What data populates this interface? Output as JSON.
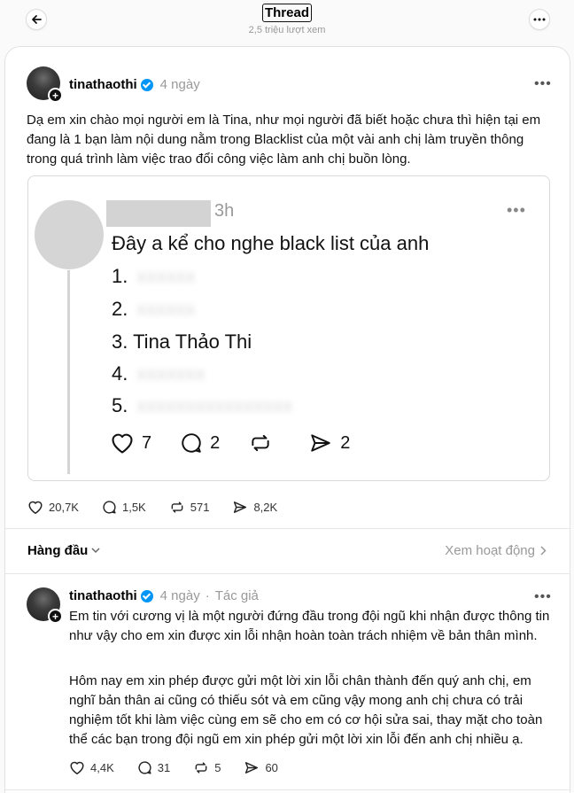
{
  "header": {
    "title": "Thread",
    "views": "2,5 triệu lượt xem"
  },
  "post": {
    "username": "tinathaothi",
    "time": "4 ngày",
    "text": "Dạ em xin chào mọi người em là Tina, như mọi người đã biết hoặc chưa thì hiện tại em đang là 1 bạn làm nội dung nằm trong Blacklist của một vài anh chị làm truyền thông trong quá trình làm việc trao đổi công việc làm anh chị buồn lòng.",
    "embed": {
      "time": "3h",
      "text": "Đây a kể cho nghe black list của anh",
      "list": [
        "1.",
        "2.",
        "3. Tina Thảo Thi",
        "4.",
        "5."
      ],
      "likes": "7",
      "replies": "2",
      "shares": "2"
    },
    "likes": "20,7K",
    "replies": "1,5K",
    "reposts": "571",
    "shares": "8,2K"
  },
  "sort": {
    "label": "Hàng đầu",
    "activity": "Xem hoạt động"
  },
  "reply": {
    "username": "tinathaothi",
    "time": "4 ngày",
    "author_tag": "Tác giả",
    "paragraph1": "Em tin với cương vị là một người đứng đầu trong đội ngũ khi nhận được thông tin như vậy cho em xin được xin lỗi nhận hoàn toàn trách nhiệm về bản thân mình.",
    "paragraph2": "Hôm nay em xin phép được gửi một lời xin lỗi chân thành đến quý anh chị, em nghĩ bản thân ai cũng có thiếu sót và em cũng vậy mong anh chị chưa có trải nghiệm tốt khi làm việc cùng em sẽ cho em có cơ hội sửa sai, thay mặt cho toàn thể các bạn trong đội ngũ em xin phép gửi một lời xin lỗi đến anh chị nhiều ạ.",
    "likes": "4,4K",
    "replies": "31",
    "reposts": "5",
    "shares": "60"
  },
  "icons": {
    "back": "arrow-left-icon",
    "more": "more-horizontal-icon",
    "like": "heart-icon",
    "reply": "comment-icon",
    "repost": "repost-icon",
    "share": "send-icon",
    "verified": "verified-badge-icon"
  },
  "colors": {
    "verified": "#0095f6",
    "muted": "#999999"
  }
}
